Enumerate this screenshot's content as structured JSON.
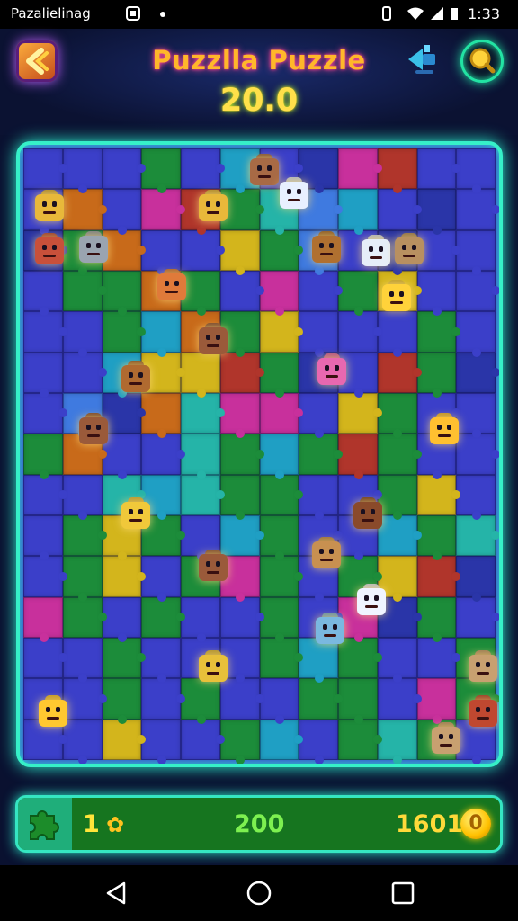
{
  "status": {
    "app_name": "Pazalielinag",
    "time": "1:33"
  },
  "header": {
    "title": "Puzzlla Puzzle",
    "score": "20.0"
  },
  "bottom": {
    "count": "1",
    "mid_value": "200",
    "coins": "1601",
    "coin_symbol": "0"
  },
  "colors": {
    "accent": "#36f0c8",
    "title": "#ffb72a",
    "score": "#ffe04a",
    "bar": "#16751f"
  },
  "board": {
    "cols": 12,
    "rows": 15,
    "palette": {
      "b": "#3b3fc9",
      "c": "#1f9fc4",
      "g": "#1c8c3a",
      "t": "#25b4a8",
      "p": "#c8309c",
      "y": "#d3b51c",
      "o": "#c86a1a",
      "r": "#b0352b",
      "d": "#2a35a8",
      "l": "#3f7ae0",
      "m": "#8a45d0"
    },
    "tiles": [
      "bbbgbcbdprbb",
      "bobprgtlcbdb",
      "dgobbyglbdbb",
      "bggogbpbgybb",
      "bbgcogybbbgb",
      "bbcyyrgdbrgd",
      "bldotppbygbb",
      "gobbtgcgrgbb",
      "bbtctggbbgyb",
      "bgygbcgbbcgt",
      "bgybgpgbgyrd",
      "pgbgbbgbpdgb",
      "bbgbbbgcgbbg",
      "bbgbgbbggbpg",
      "bbybbgcbgtgb"
    ],
    "characters": [
      {
        "name": "brown-cat-character",
        "color": "#a86a45"
      },
      {
        "name": "white-ghost-character",
        "color": "#e8f0ff"
      },
      {
        "name": "yellow-robot-character",
        "color": "#e8b83a"
      },
      {
        "name": "yellow-robot-character",
        "color": "#e8b83a"
      },
      {
        "name": "red-cat-character",
        "color": "#c8503a"
      },
      {
        "name": "gray-robot-character",
        "color": "#9aa4b0"
      },
      {
        "name": "brown-dog-character",
        "color": "#b07030"
      },
      {
        "name": "white-cat-character",
        "color": "#e6eef8"
      },
      {
        "name": "tan-robot-character",
        "color": "#b89060"
      },
      {
        "name": "orange-robot-character",
        "color": "#e07a3a"
      },
      {
        "name": "yellow-block-character",
        "color": "#ffd23a"
      },
      {
        "name": "brown-bear-character",
        "color": "#9a5a3a"
      },
      {
        "name": "brown-dog-character",
        "color": "#b06a30"
      },
      {
        "name": "pink-robot-character",
        "color": "#e868b0"
      },
      {
        "name": "brown-bear-character",
        "color": "#9a5a3a"
      },
      {
        "name": "yellow-cat-character",
        "color": "#ffc030"
      },
      {
        "name": "yellow-robot-character",
        "color": "#f0c83a"
      },
      {
        "name": "brown-robot-character",
        "color": "#8a4a2a"
      },
      {
        "name": "brown-robot-character",
        "color": "#9a5a3a"
      },
      {
        "name": "tan-dog-character",
        "color": "#c89050"
      },
      {
        "name": "white-cat-character",
        "color": "#f0f4ff"
      },
      {
        "name": "blue-ghost-character",
        "color": "#7ab8e0"
      },
      {
        "name": "yellow-robot-character",
        "color": "#e8c03a"
      },
      {
        "name": "tan-robot-character",
        "color": "#c8a070"
      },
      {
        "name": "yellow-cat-character",
        "color": "#ffc830"
      },
      {
        "name": "red-cat-character",
        "color": "#c04830"
      },
      {
        "name": "tan-robot-character",
        "color": "#c8a070"
      }
    ]
  }
}
